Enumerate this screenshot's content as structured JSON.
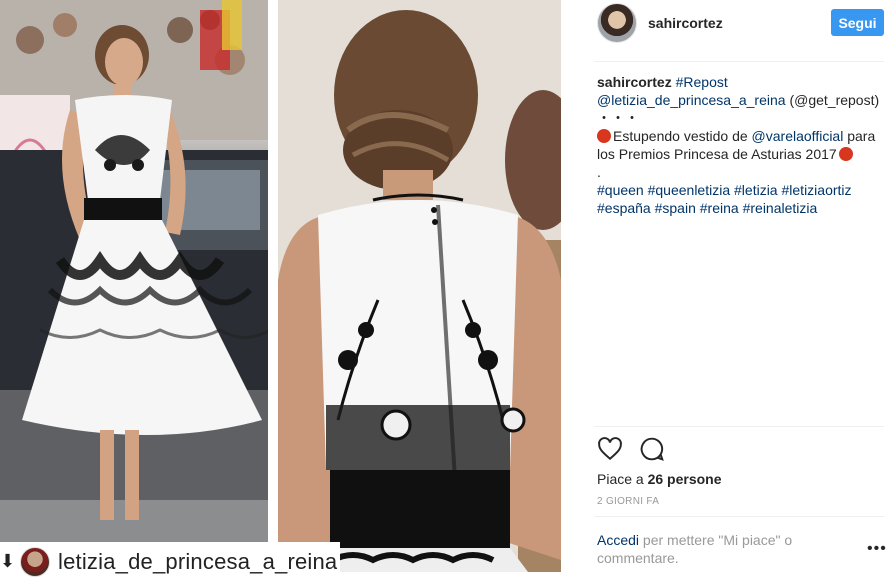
{
  "post": {
    "repost_username": "letizia_de_princesa_a_reina"
  },
  "header": {
    "username": "sahircortez",
    "follow_label": "Segui"
  },
  "caption": {
    "username": "sahircortez",
    "hashtag_repost": "#Repost",
    "mention_source": "@letizia_de_princesa_a_reina",
    "get_repost": "(@get_repost)",
    "dots": "・・・",
    "text_before_mention": "Estupendo vestido de",
    "mention_designer": "@varelaofficial",
    "text_after_mention": "para",
    "text_line2": "los Premios Princesa de Asturias 2017",
    "period": ".",
    "hashtags_line1": [
      "#queen",
      "#queenletizia",
      "#letizia",
      "#letiziaortiz"
    ],
    "hashtags_line2": [
      "#españa",
      "#spain",
      "#reina",
      "#reinaletizia"
    ]
  },
  "likes": {
    "text_prefix": "Piace a ",
    "count_text": "26 persone"
  },
  "timestamp": "2 GIORNI FA",
  "comment": {
    "login_label": "Accedi",
    "rest": " per mettere \"Mi piace\" o commentare."
  },
  "icons": {
    "like": "heart-outline-icon",
    "comment": "speech-bubble-icon",
    "more": "ellipsis-icon",
    "repost": "repost-arrow-icon"
  },
  "colors": {
    "follow_button": "#3897f0",
    "link": "#003569",
    "muted": "#999999",
    "red_emoji": "#d8361f"
  }
}
